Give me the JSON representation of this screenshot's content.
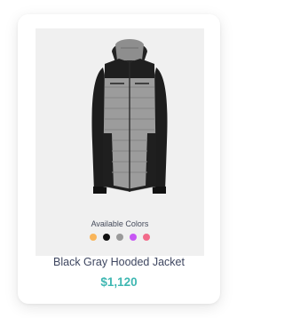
{
  "product": {
    "name": "Black Gray Hooded Jacket",
    "price": "$1,120",
    "image_icon": "hooded-jacket-image",
    "colors_label": "Available Colors",
    "colors": [
      {
        "name": "orange",
        "hex": "#f9b55a"
      },
      {
        "name": "black",
        "hex": "#111111"
      },
      {
        "name": "gray",
        "hex": "#9a9a9a"
      },
      {
        "name": "purple",
        "hex": "#c757f4"
      },
      {
        "name": "pink",
        "hex": "#f26b8a"
      }
    ]
  },
  "theme": {
    "panel_bg": "#f0f0f0",
    "title_color": "#3e4660",
    "price_color": "#3fb7b2"
  }
}
